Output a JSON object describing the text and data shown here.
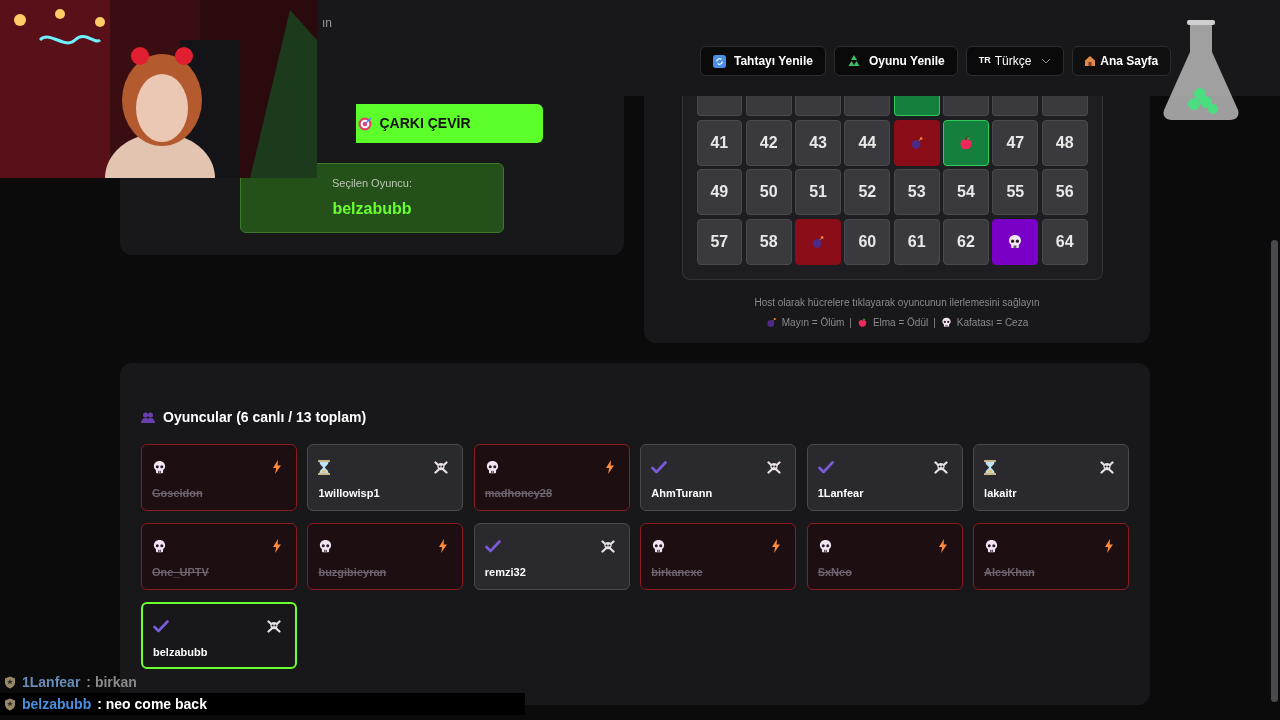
{
  "header": {
    "partial_text": "ın",
    "buttons": [
      {
        "kind": "board",
        "label": "Tahtayı Yenile"
      },
      {
        "kind": "game",
        "label": "Oyunu Yenile"
      }
    ],
    "language": {
      "code": "TR",
      "label": "Türkçe"
    },
    "home": {
      "label": "Ana Sayfa"
    }
  },
  "spin": {
    "button": "ÇARKI ÇEVİR",
    "selected_label": "Seçilen Oyuncu:",
    "selected_player": "belzabubb"
  },
  "board": {
    "partial_row": [
      {
        "kind": "number"
      },
      {
        "kind": "number"
      },
      {
        "kind": "number"
      },
      {
        "kind": "number"
      },
      {
        "kind": "apple"
      },
      {
        "kind": "number"
      },
      {
        "kind": "number"
      },
      {
        "kind": "number"
      }
    ],
    "rows": [
      [
        {
          "kind": "number",
          "label": "41"
        },
        {
          "kind": "number",
          "label": "42"
        },
        {
          "kind": "number",
          "label": "43"
        },
        {
          "kind": "number",
          "label": "44"
        },
        {
          "kind": "mine"
        },
        {
          "kind": "apple"
        },
        {
          "kind": "number",
          "label": "47"
        },
        {
          "kind": "number",
          "label": "48"
        }
      ],
      [
        {
          "kind": "number",
          "label": "49"
        },
        {
          "kind": "number",
          "label": "50"
        },
        {
          "kind": "number",
          "label": "51"
        },
        {
          "kind": "number",
          "label": "52"
        },
        {
          "kind": "number",
          "label": "53"
        },
        {
          "kind": "number",
          "label": "54"
        },
        {
          "kind": "number",
          "label": "55"
        },
        {
          "kind": "number",
          "label": "56"
        }
      ],
      [
        {
          "kind": "number",
          "label": "57"
        },
        {
          "kind": "number",
          "label": "58"
        },
        {
          "kind": "mine"
        },
        {
          "kind": "number",
          "label": "60"
        },
        {
          "kind": "number",
          "label": "61"
        },
        {
          "kind": "number",
          "label": "62"
        },
        {
          "kind": "skull"
        },
        {
          "kind": "number",
          "label": "64"
        }
      ]
    ],
    "hint": "Host olarak hücrelere tıklayarak oyuncunun ilerlemesini sağlayın",
    "separator": "|",
    "legend": [
      {
        "kind": "mine",
        "text": "Mayın = Ölüm"
      },
      {
        "kind": "apple",
        "text": "Elma = Ödül"
      },
      {
        "kind": "skull",
        "text": "Kafatası = Ceza"
      }
    ]
  },
  "players": {
    "title": "Oyuncular (6 canlı / 13 toplam)",
    "items": [
      {
        "name": "Goseidon",
        "kind": "dead",
        "selected": false
      },
      {
        "name": "1willowisp1",
        "kind": "waiting",
        "selected": false
      },
      {
        "name": "madhoney28",
        "kind": "dead",
        "selected": false
      },
      {
        "name": "AhmTurann",
        "kind": "ready",
        "selected": false
      },
      {
        "name": "1Lanfear",
        "kind": "ready",
        "selected": false
      },
      {
        "name": "lakaitr",
        "kind": "waiting",
        "selected": false
      },
      {
        "name": "One_UPTV",
        "kind": "dead",
        "selected": false
      },
      {
        "name": "buzgibieyran",
        "kind": "dead",
        "selected": false
      },
      {
        "name": "remzi32",
        "kind": "ready",
        "selected": false
      },
      {
        "name": "birkanexe",
        "kind": "dead",
        "selected": false
      },
      {
        "name": "SxNeo",
        "kind": "dead",
        "selected": false
      },
      {
        "name": "AlesKhan",
        "kind": "dead",
        "selected": false
      },
      {
        "name": "belzabubb",
        "kind": "ready",
        "selected": true
      }
    ]
  },
  "chat": [
    {
      "user": "1Lanfear",
      "text": ": birkan",
      "faded": true
    },
    {
      "user": "belzabubb",
      "text": ": neo come back",
      "faded": false
    }
  ]
}
